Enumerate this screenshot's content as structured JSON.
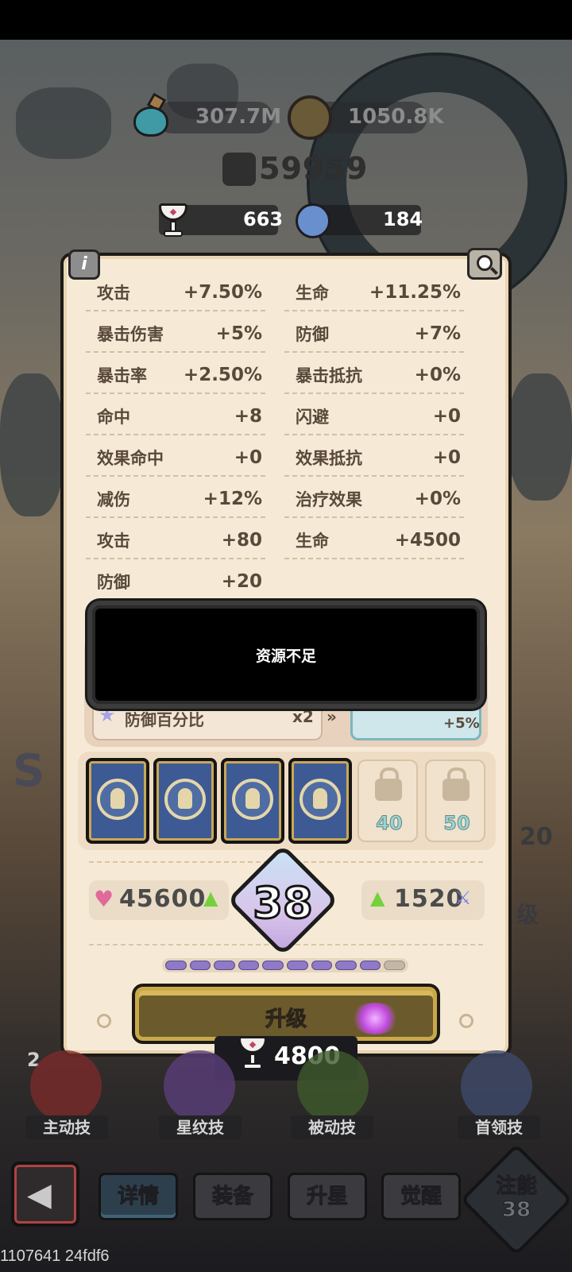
{
  "resources": {
    "potion_value": "307.7M",
    "coin_value": "1050.8K",
    "power_value": "59959",
    "chalice_value": "663",
    "orb_value": "184"
  },
  "stats": [
    {
      "label": "攻击",
      "value": "+7.50%"
    },
    {
      "label": "生命",
      "value": "+11.25%"
    },
    {
      "label": "暴击伤害",
      "value": "+5%"
    },
    {
      "label": "防御",
      "value": "+7%"
    },
    {
      "label": "暴击率",
      "value": "+2.50%"
    },
    {
      "label": "暴击抵抗",
      "value": "+0%"
    },
    {
      "label": "命中",
      "value": "+8"
    },
    {
      "label": "闪避",
      "value": "+0"
    },
    {
      "label": "效果命中",
      "value": "+0"
    },
    {
      "label": "效果抵抗",
      "value": "+0"
    },
    {
      "label": "减伤",
      "value": "+12%"
    },
    {
      "label": "治疗效果",
      "value": "+0%"
    },
    {
      "label": "攻击",
      "value": "+80"
    },
    {
      "label": "生命",
      "value": "+4500"
    },
    {
      "label": "防御",
      "value": "+20"
    }
  ],
  "toast": {
    "message": "资源不足"
  },
  "upgrade_row": {
    "left_label": "防御百分比",
    "left_multiplier": "x2",
    "right_value": "+5%"
  },
  "locks": [
    {
      "level": "40"
    },
    {
      "level": "50"
    }
  ],
  "costs": {
    "left_value": "45600",
    "right_value": "1520"
  },
  "level": {
    "value": "38"
  },
  "progress": {
    "filled": 9,
    "total": 10
  },
  "upgrade_button": {
    "label": "升级"
  },
  "upgrade_cost": {
    "value": "4800"
  },
  "skills": [
    {
      "label": "主动技"
    },
    {
      "label": "星纹技"
    },
    {
      "label": "被动技"
    },
    {
      "label": "首领技"
    }
  ],
  "tabs": [
    {
      "label": "详情"
    },
    {
      "label": "装备"
    },
    {
      "label": "升星"
    },
    {
      "label": "觉醒"
    }
  ],
  "energy": {
    "line1": "注能",
    "line2": "38"
  },
  "side": {
    "right_number": "20",
    "right_partial": "级",
    "left_badge": "2"
  },
  "footer": {
    "debug_text": "1107641 24fdf6"
  },
  "colors": {
    "panel_bg": "#f6ead7",
    "card_blue": "#3d5a94",
    "progress_fill": "#8e7ac6",
    "upgrade_gold": "#c9a84a"
  }
}
